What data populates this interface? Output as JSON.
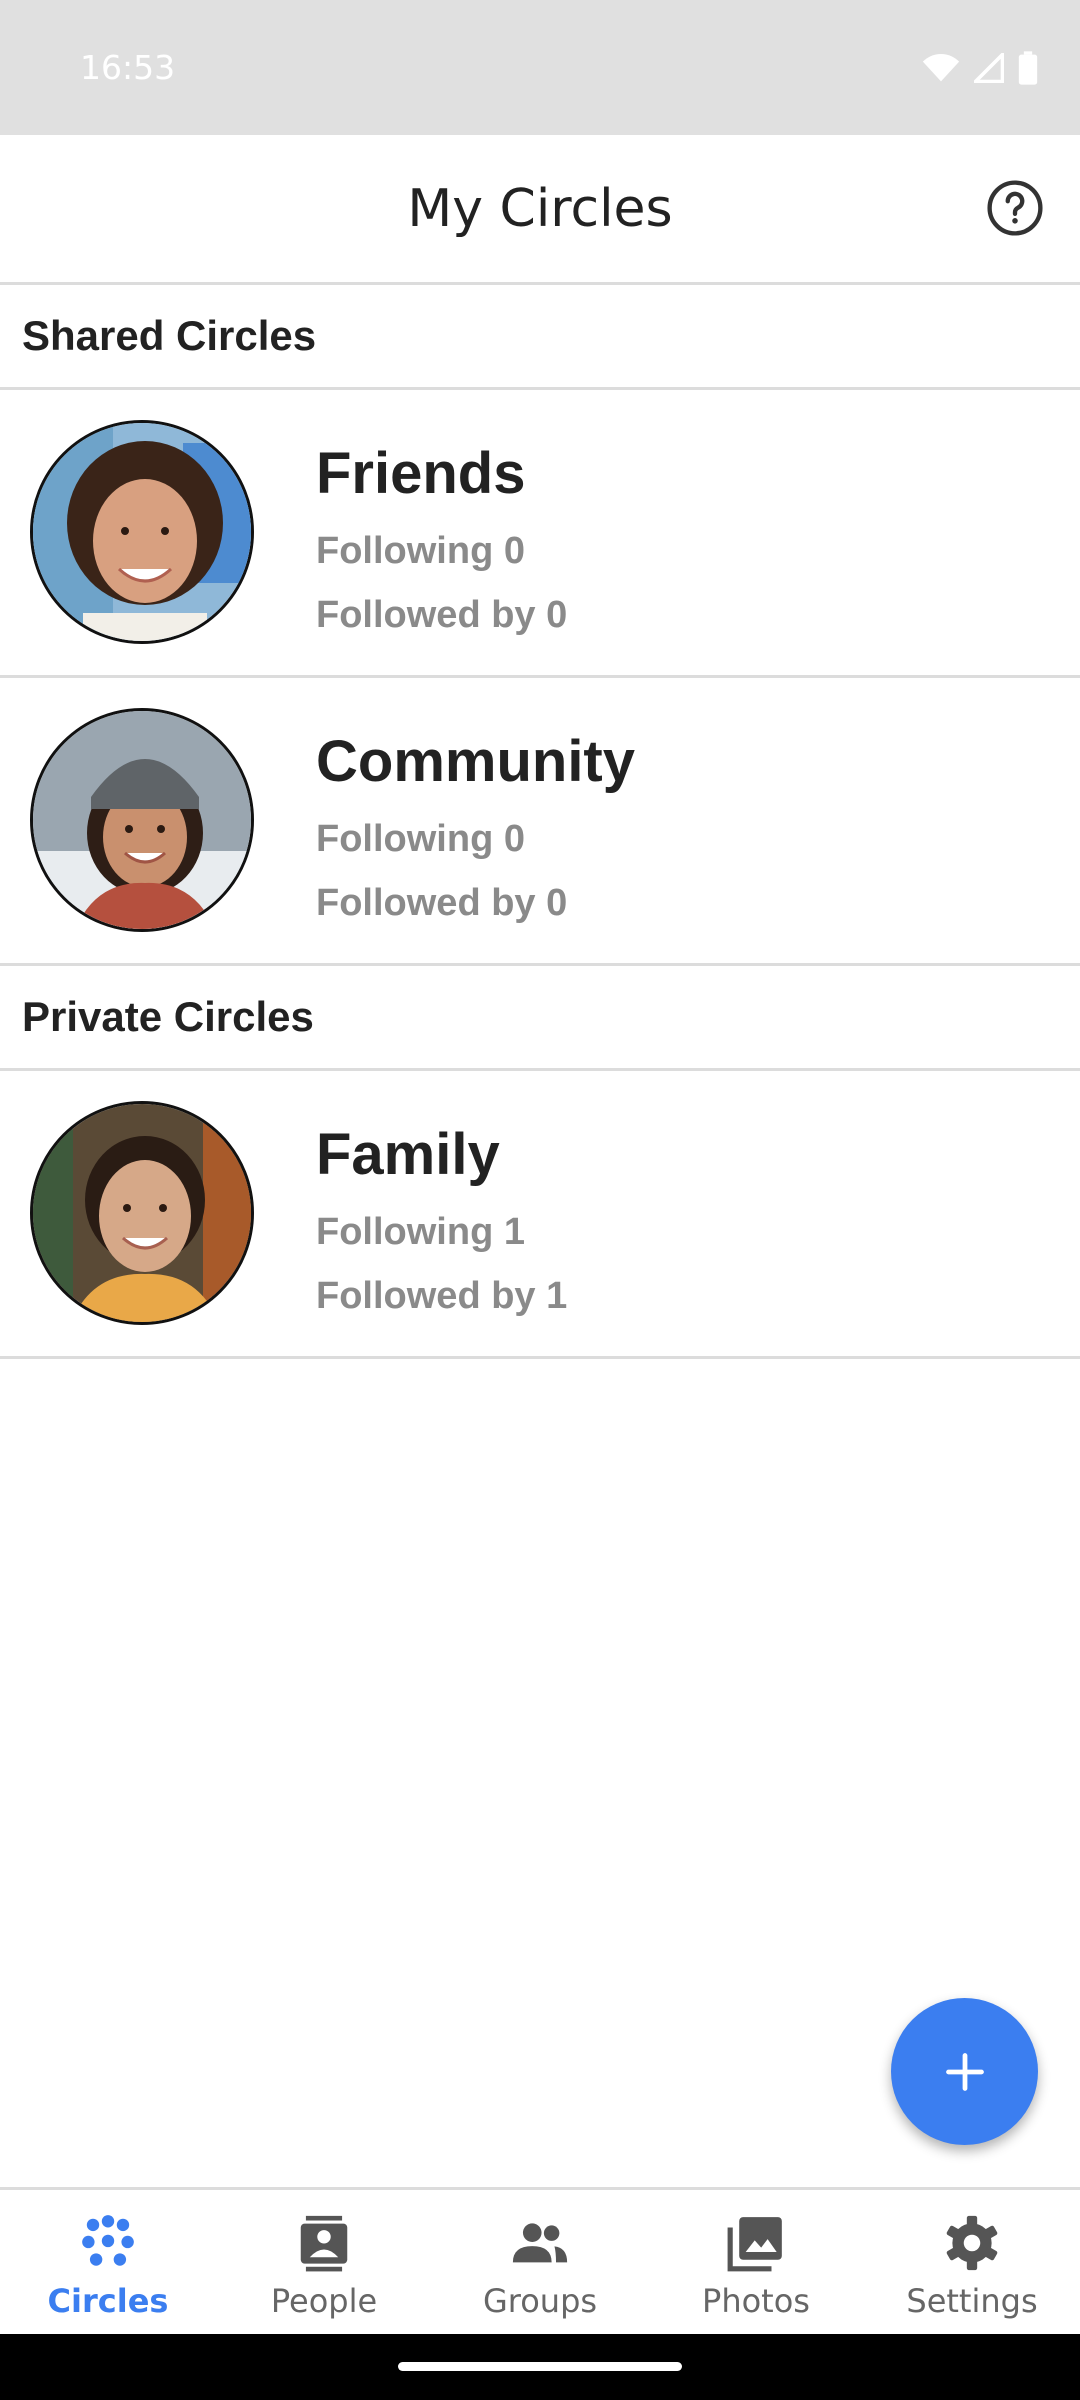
{
  "status_bar": {
    "time": "16:53"
  },
  "header": {
    "title": "My Circles"
  },
  "sections": [
    {
      "title": "Shared Circles",
      "circles": [
        {
          "name": "Friends",
          "following": "Following 0",
          "followed_by": "Followed by 0"
        },
        {
          "name": "Community",
          "following": "Following 0",
          "followed_by": "Followed by 0"
        }
      ]
    },
    {
      "title": "Private Circles",
      "circles": [
        {
          "name": "Family",
          "following": "Following 1",
          "followed_by": "Followed by 1"
        }
      ]
    }
  ],
  "bottom_nav": {
    "items": [
      {
        "label": "Circles",
        "icon": "circles-icon",
        "active": true
      },
      {
        "label": "People",
        "icon": "contact-icon",
        "active": false
      },
      {
        "label": "Groups",
        "icon": "groups-icon",
        "active": false
      },
      {
        "label": "Photos",
        "icon": "photos-icon",
        "active": false
      },
      {
        "label": "Settings",
        "icon": "gear-icon",
        "active": false
      }
    ]
  },
  "colors": {
    "accent": "#3b7ef0",
    "secondary_text": "#8a8a8a",
    "divider": "#dcdcdc"
  }
}
